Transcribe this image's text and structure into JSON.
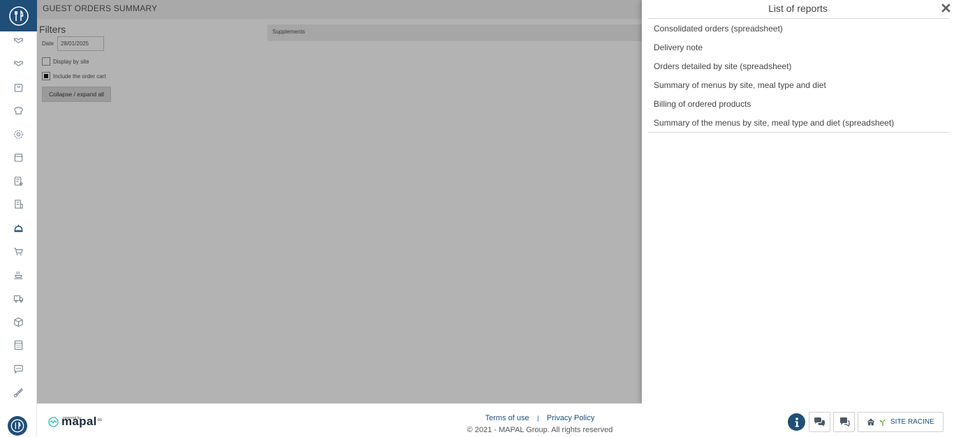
{
  "sidebar": {
    "items": [
      {
        "icon": "handshake-icon"
      },
      {
        "icon": "handshake-icon"
      },
      {
        "icon": "shopping-bag-icon"
      },
      {
        "icon": "chef-hat-icon"
      },
      {
        "icon": "gear-icon"
      },
      {
        "icon": "box-icon"
      },
      {
        "icon": "recipe-card-icon"
      },
      {
        "icon": "receipt-icon"
      },
      {
        "icon": "service-bell-icon"
      },
      {
        "icon": "cart-icon"
      },
      {
        "icon": "hot-dish-icon"
      },
      {
        "icon": "delivery-truck-icon"
      },
      {
        "icon": "packages-icon"
      },
      {
        "icon": "calculator-icon"
      },
      {
        "icon": "chat-icon"
      },
      {
        "icon": "thermometer-icon"
      }
    ]
  },
  "main": {
    "title": "GUEST ORDERS SUMMARY",
    "filters_title": "Filters",
    "date_label": "Date",
    "date_value": "28/01/2025",
    "display_by_site_label": "Display by site",
    "display_by_site_checked": false,
    "include_cart_label": "Include the order cart",
    "include_cart_checked": true,
    "collapse_label": "Collapse / expand all",
    "supplements_label": "Supplements"
  },
  "panel": {
    "title": "List of reports",
    "reports": [
      "Consolidated orders (spreadsheet)",
      "Delivery note",
      "Orders detailed by site (spreadsheet)",
      "Summary of menus by site, meal type and diet",
      "Billing of ordered products",
      "Summary of the menus by site, meal type and diet (spreadsheet)"
    ]
  },
  "footer": {
    "powered_by": "powered by",
    "brand": "mapal",
    "brand_suffix": "os",
    "terms": "Terms of use",
    "separator": "|",
    "privacy": "Privacy Policy",
    "copyright": "© 2021 - MAPAL Group. All rights reserved",
    "site_label": "SITE RACINE"
  },
  "colors": {
    "accent": "#1f4e79",
    "overlay": "#b3b3b3"
  }
}
